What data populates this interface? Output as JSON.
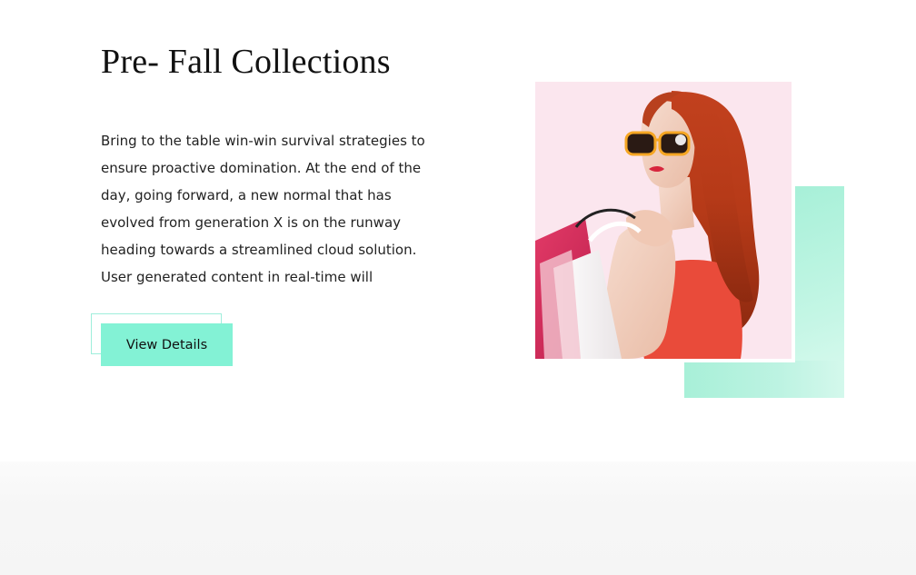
{
  "section": {
    "title": "Pre- Fall Collections",
    "body": "Bring to the table win-win survival strategies to\nensure proactive domination. At the end of the\nday, going forward, a new normal that has\nevolved from generation X is on the runway\nheading towards a streamlined cloud solution.\nUser generated content in real-time will",
    "button_label": "View Details"
  },
  "image": {
    "subject": "woman-with-shopping-bags-photo"
  },
  "colors": {
    "accent": "#83f2d5",
    "accent_light": "#c4f6e5",
    "photo_background": "#fbe6ee",
    "band_background": "#f6f6f6",
    "text": "#111111"
  }
}
